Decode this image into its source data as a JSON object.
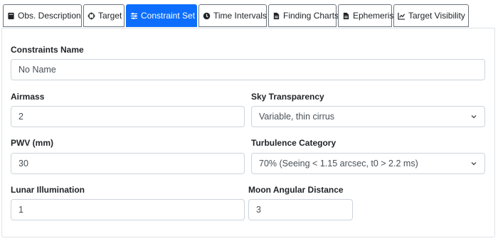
{
  "tabs": [
    {
      "label": "Obs. Description",
      "icon": "book-icon",
      "active": false
    },
    {
      "label": "Target",
      "icon": "crosshair-icon",
      "active": false
    },
    {
      "label": "Constraint Set",
      "icon": "sliders-icon",
      "active": true
    },
    {
      "label": "Time Intervals",
      "icon": "clock-icon",
      "active": false
    },
    {
      "label": "Finding Charts",
      "icon": "document-icon",
      "active": false
    },
    {
      "label": "Ephemeris",
      "icon": "file-icon",
      "active": false
    },
    {
      "label": "Target Visibility",
      "icon": "line-chart-icon",
      "active": false
    }
  ],
  "form": {
    "constraints_name": {
      "label": "Constraints Name",
      "value": "No Name"
    },
    "airmass": {
      "label": "Airmass",
      "value": "2"
    },
    "sky_transparency": {
      "label": "Sky Transparency",
      "value": "Variable, thin cirrus"
    },
    "pwv": {
      "label": "PWV (mm)",
      "value": "30"
    },
    "turbulence": {
      "label": "Turbulence Category",
      "value": "70% (Seeing < 1.15 arcsec, t0 > 2.2 ms)"
    },
    "lunar_illumination": {
      "label": "Lunar Illumination",
      "value": "1"
    },
    "moon_distance": {
      "label": "Moon Angular Distance",
      "value": "3"
    }
  },
  "colors": {
    "accent": "#0d6efd",
    "border": "#ced4da",
    "tab_border": "#6c757d"
  }
}
